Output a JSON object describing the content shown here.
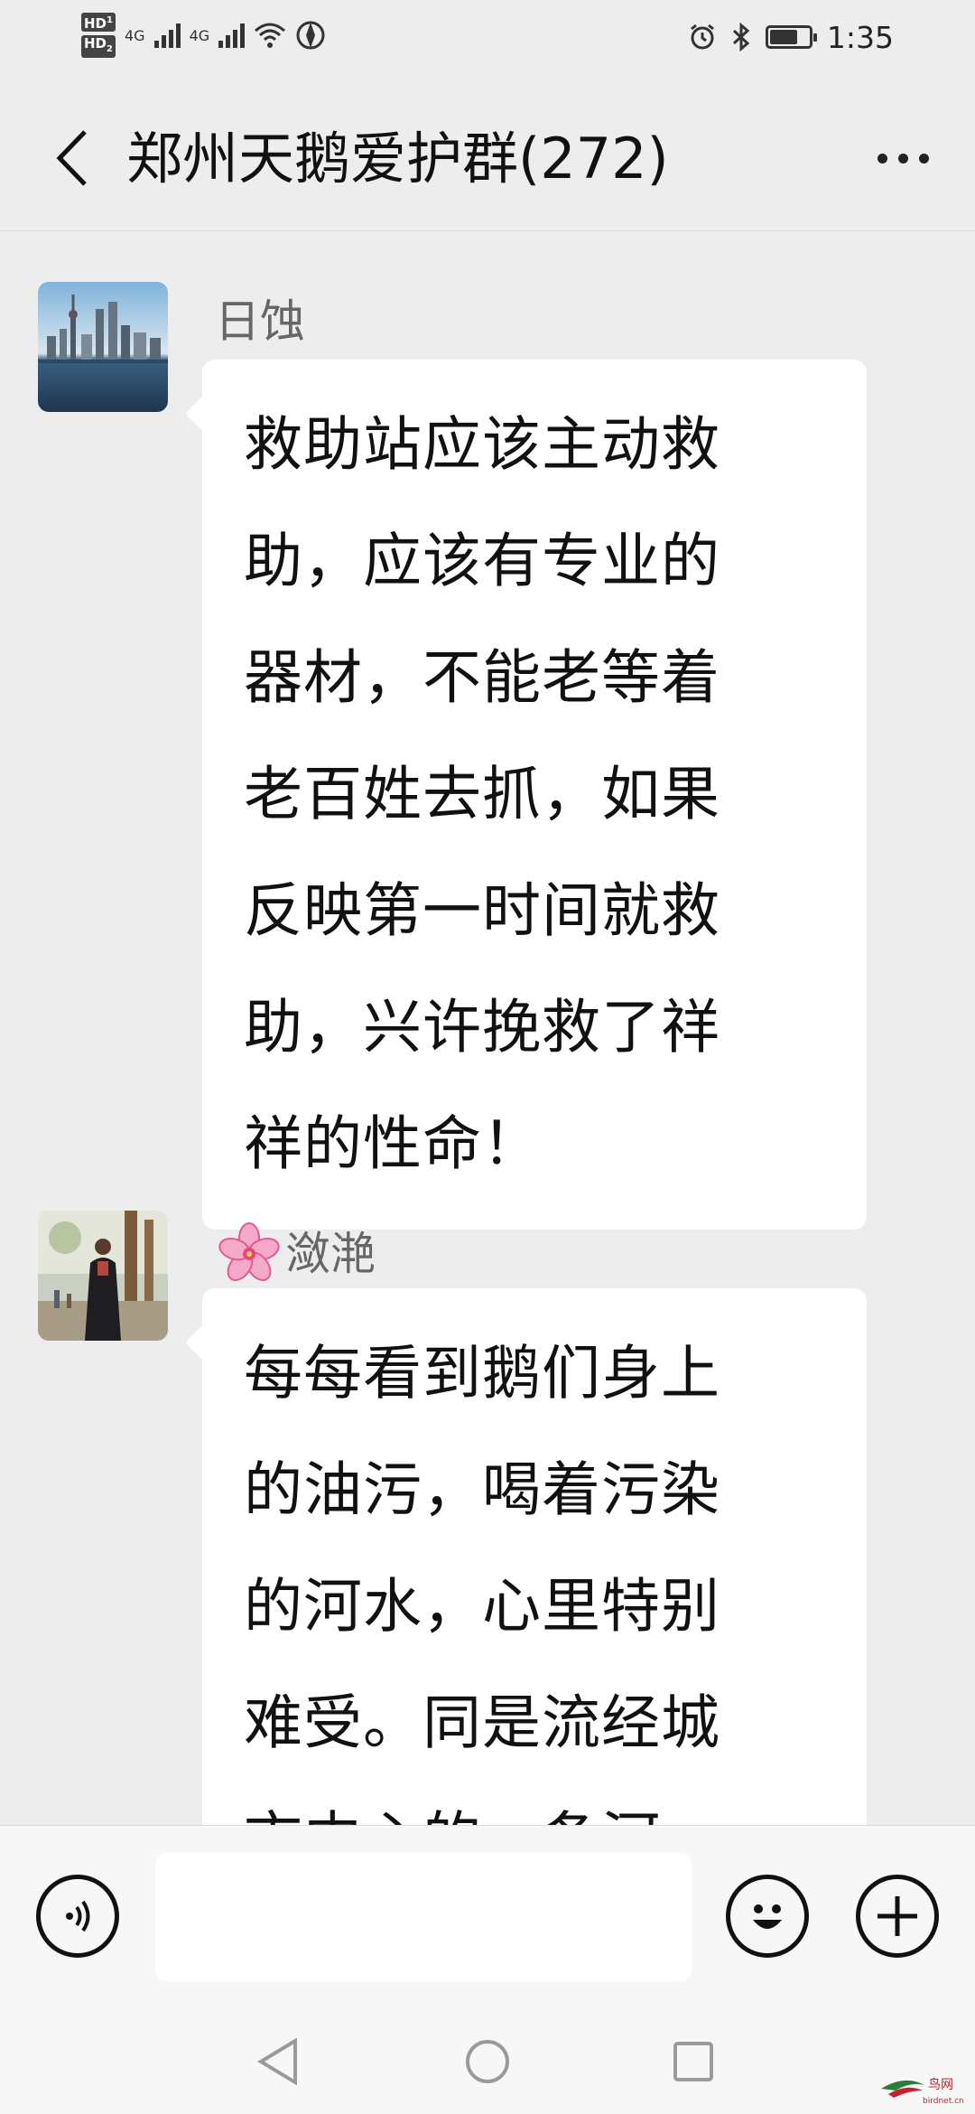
{
  "status_bar": {
    "sim1_badge": "HD",
    "sim1_num": "1",
    "sim2_badge": "HD",
    "sim2_num": "2",
    "network1": "4G",
    "network2": "4G",
    "time": "1:35",
    "battery_level": 0.75,
    "icons": [
      "alarm-icon",
      "bluetooth-icon",
      "battery-icon",
      "wifi-icon",
      "hotspot-icon"
    ]
  },
  "header": {
    "title": "郑州天鹅爱护群(272)"
  },
  "messages": [
    {
      "sender": "日蚀",
      "text": "救助站应该主动救助，应该有专业的器材，不能老等着老百姓去抓，如果反映第一时间就救助，兴许挽救了祥祥的性命！",
      "lines": [
        "救助站应该主动救",
        "助，应该有专业的",
        "器材，不能老等着",
        "老百姓去抓，如果",
        "反映第一时间就救",
        "助，兴许挽救了祥",
        "祥的性命！"
      ]
    },
    {
      "sender_emoji": "🌸",
      "sender": "潋滟",
      "text": "每每看到鹅们身上的油污，喝着污染的河水，心里特别难受。同是流经城市中心的一条河",
      "lines": [
        "每每看到鹅们身上",
        "的油污，喝着污染",
        "的河水，心里特别",
        "难受。同是流经城",
        "市中心的一条河"
      ]
    }
  ],
  "input_bar": {
    "text_value": ""
  },
  "watermark": {
    "text": "鸟网",
    "subtext": "birdnet.cn"
  },
  "colors": {
    "background": "#ededed",
    "bubble": "#ffffff",
    "text": "#111111",
    "sender": "#666666",
    "bar": "#f7f7f7"
  }
}
